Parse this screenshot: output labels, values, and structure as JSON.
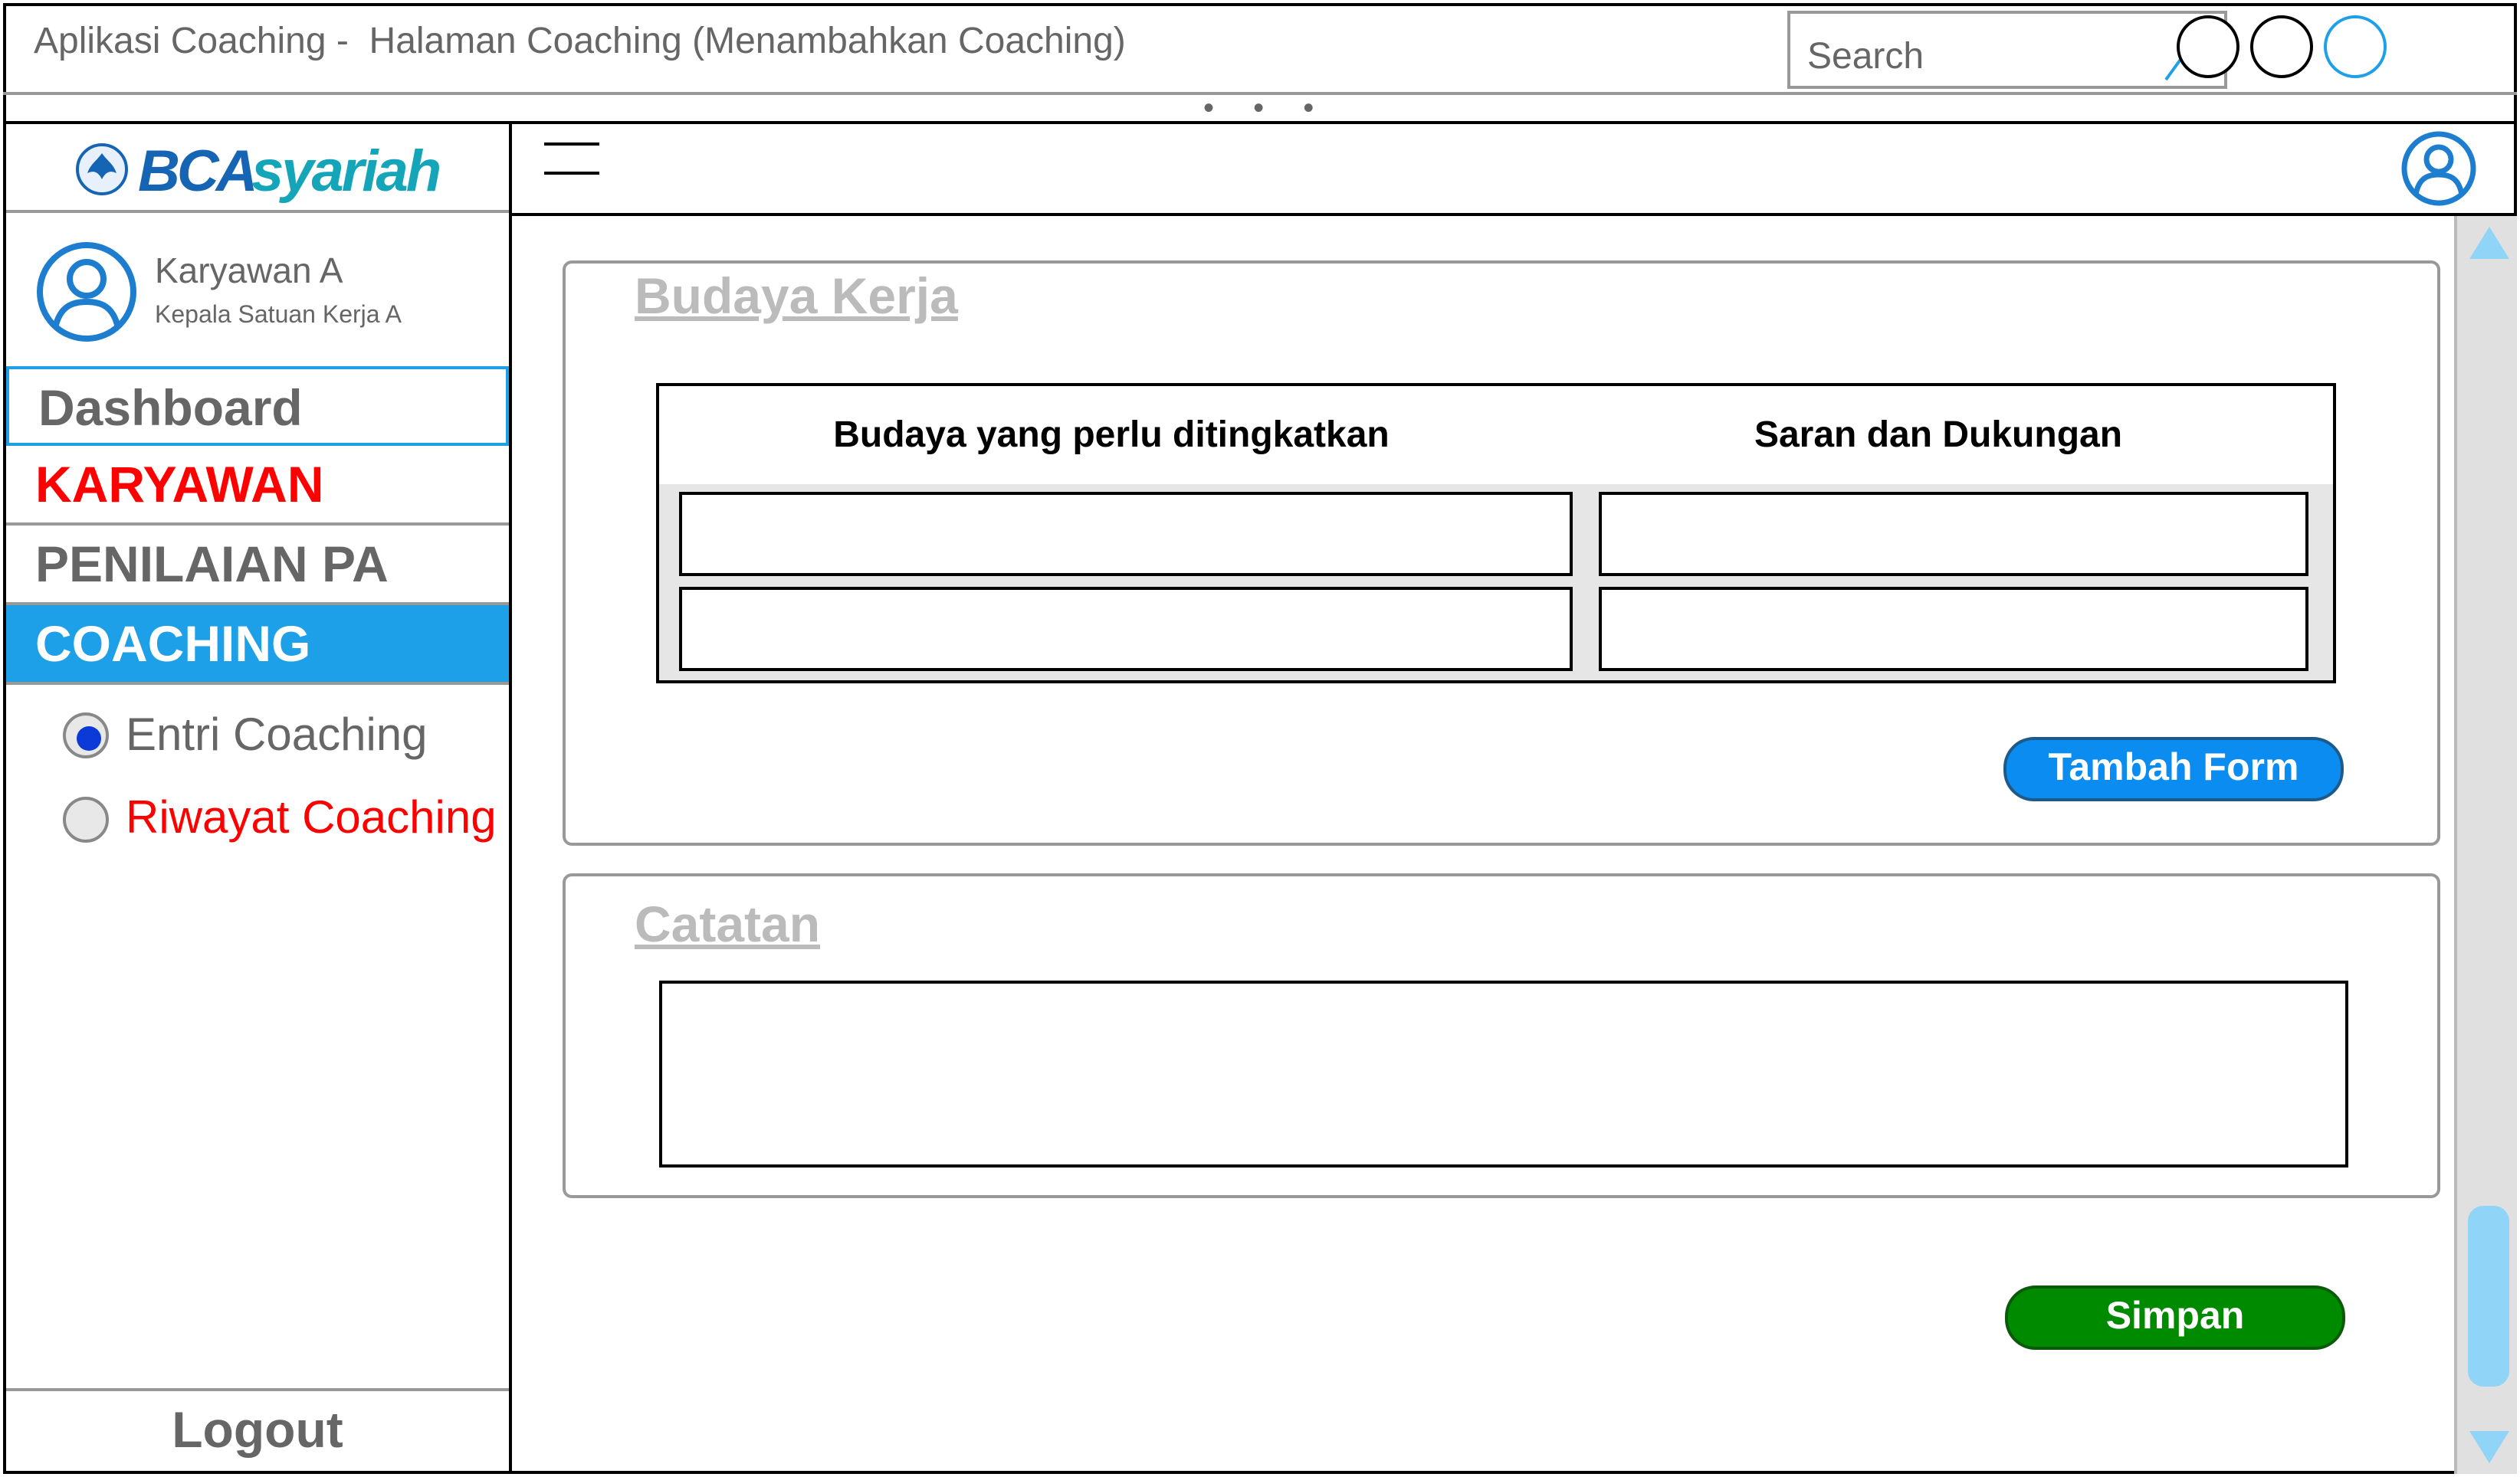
{
  "window": {
    "title": "Aplikasi Coaching -  Halaman Coaching (Menambahkan Coaching)",
    "search_placeholder": "Search",
    "dots": "• • •"
  },
  "logo": {
    "bca": "BCA",
    "syariah": "syariah"
  },
  "user": {
    "name": "Karyawan A",
    "role": "Kepala Satuan Kerja A"
  },
  "nav": {
    "dashboard": "Dashboard",
    "karyawan": "KARYAWAN",
    "penilaian": "PENILAIAN PA",
    "coaching": "COACHING",
    "sub": [
      {
        "label": "Entri Coaching",
        "selected": true
      },
      {
        "label": "Riwayat Coaching",
        "selected": false
      }
    ],
    "logout": "Logout"
  },
  "budaya": {
    "title": "Budaya Kerja",
    "columns": [
      "Budaya yang perlu ditingkatkan",
      "Saran dan Dukungan"
    ],
    "rows": [
      [
        "",
        ""
      ],
      [
        "",
        ""
      ]
    ],
    "add_button": "Tambah Form"
  },
  "catatan": {
    "title": "Catatan",
    "value": ""
  },
  "save_button": "Simpan",
  "colors": {
    "accent": "#1ea0e8",
    "danger": "#ff0000",
    "add_button": "#0a8cf0",
    "save_button": "#008a00",
    "muted_title": "#bbbbbb"
  }
}
